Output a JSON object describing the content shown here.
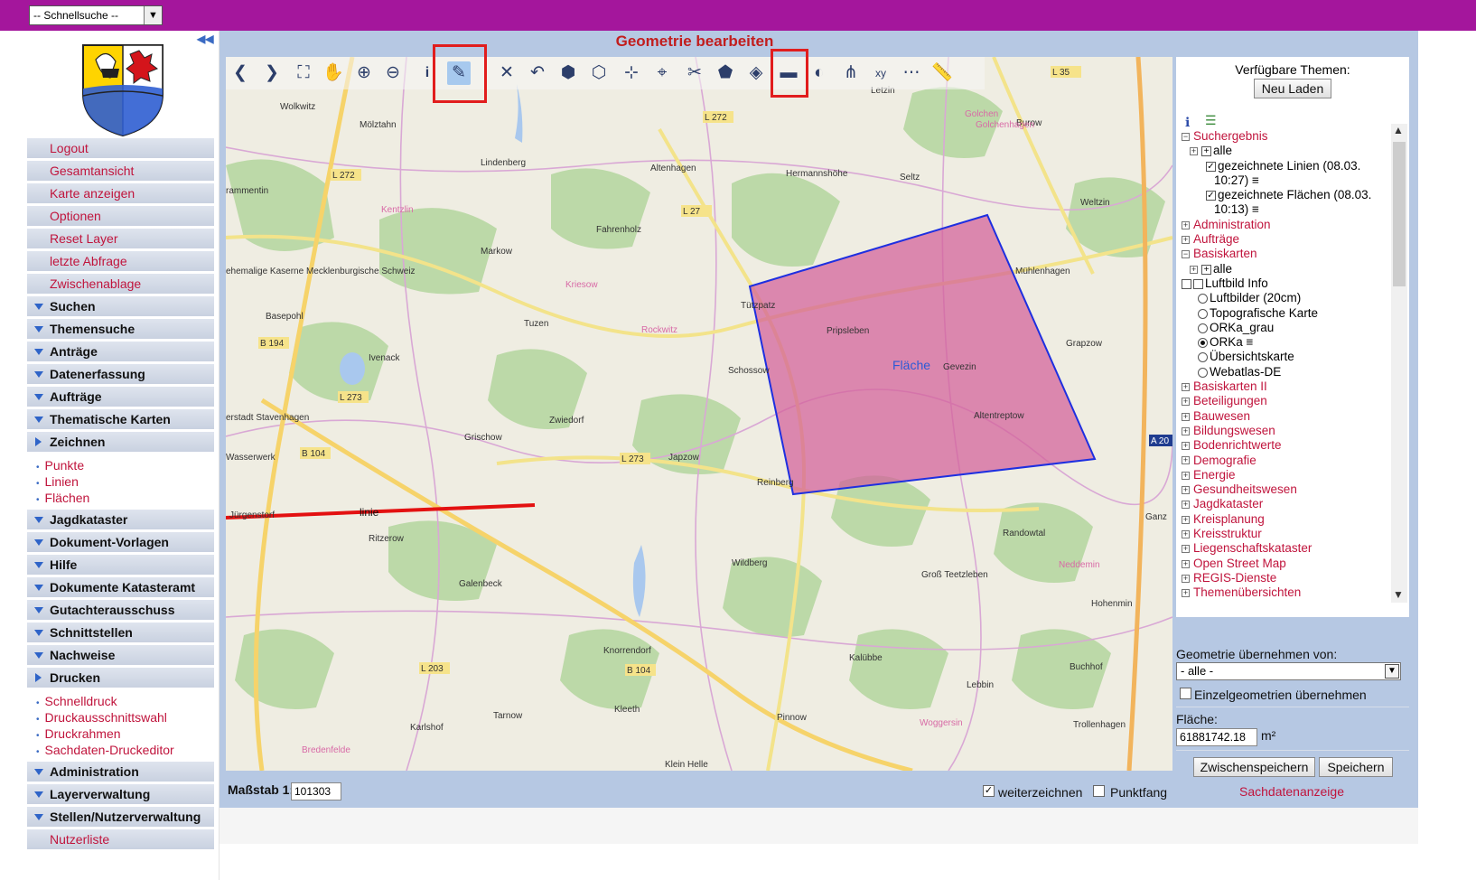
{
  "quicksearch": {
    "value": "-- Schnellsuche --"
  },
  "sidebar": {
    "collapse_icon": "double-chevron-left-icon",
    "menu": [
      {
        "label": "Logout",
        "kind": "red"
      },
      {
        "label": "Gesamtansicht",
        "kind": "red"
      },
      {
        "label": "Karte anzeigen",
        "kind": "red"
      },
      {
        "label": "Optionen",
        "kind": "red"
      },
      {
        "label": "Reset Layer",
        "kind": "red"
      },
      {
        "label": "letzte Abfrage",
        "kind": "red"
      },
      {
        "label": "Zwischenablage",
        "kind": "red"
      },
      {
        "label": "Suchen",
        "kind": "section"
      },
      {
        "label": "Themensuche",
        "kind": "section"
      },
      {
        "label": "Anträge",
        "kind": "section"
      },
      {
        "label": "Datenerfassung",
        "kind": "section"
      },
      {
        "label": "Aufträge",
        "kind": "section"
      },
      {
        "label": "Thematische Karten",
        "kind": "section"
      },
      {
        "label": "Zeichnen",
        "kind": "section-open",
        "sub": [
          "Punkte",
          "Linien",
          "Flächen"
        ]
      },
      {
        "label": "Jagdkataster",
        "kind": "section"
      },
      {
        "label": "Dokument-Vorlagen",
        "kind": "section"
      },
      {
        "label": "Hilfe",
        "kind": "section"
      },
      {
        "label": "Dokumente Katasteramt",
        "kind": "section"
      },
      {
        "label": "Gutachterausschuss",
        "kind": "section"
      },
      {
        "label": "Schnittstellen",
        "kind": "section"
      },
      {
        "label": "Nachweise",
        "kind": "section"
      },
      {
        "label": "Drucken",
        "kind": "section-open",
        "sub": [
          "Schnelldruck",
          "Druckausschnittswahl",
          "Druckrahmen",
          "Sachdaten-Druckeditor"
        ]
      },
      {
        "label": "Administration",
        "kind": "section"
      },
      {
        "label": "Layerverwaltung",
        "kind": "section"
      },
      {
        "label": "Stellen/Nutzerverwaltung",
        "kind": "section"
      },
      {
        "label": "Nutzerliste",
        "kind": "red"
      }
    ]
  },
  "main": {
    "title": "Geometrie bearbeiten",
    "scale_label": "Maßstab 1:",
    "scale_value": "101303",
    "weiterzeichnen_label": "weiterzeichnen",
    "weiterzeichnen_checked": true,
    "punktfang_label": "Punktfang",
    "punktfang_checked": false
  },
  "toolbar": {
    "icons": [
      "back-arrow-icon",
      "forward-arrow-icon",
      "fullextent-icon",
      "pan-hand-icon",
      "zoom-in-icon",
      "zoom-out-icon",
      "info-icon",
      "edit-pencil-icon",
      "delete-x-icon",
      "undo-icon",
      "polygon-edit-icon",
      "polygon-split-icon",
      "add-vertex-icon",
      "select-vertex-icon",
      "cut-polygon-icon",
      "union-polygon-icon",
      "buffer-icon",
      "line-tool-icon",
      "flip-icon",
      "split-line-icon",
      "coordinate-xy-icon",
      "measure-line-icon",
      "ruler-icon"
    ],
    "active": "edit-pencil-icon"
  },
  "map": {
    "polygon_label": "Fläche",
    "line_label": "linie",
    "place_labels": [
      "Wolkwitz",
      "Mölztahn",
      "Lindenberg",
      "Altenhagen",
      "Hermannshöhe",
      "Seltz",
      "Burow",
      "Golchen",
      "Weltzin",
      "Letzin",
      "Kentzlin",
      "Fahrenholz",
      "Markow",
      "Kriesow",
      "Tützpatz",
      "Tuzen",
      "Rockwitz",
      "Basepohl",
      "Ivenack",
      "Schossow",
      "Mühlenhagen",
      "Grapzow",
      "Zwiedorf",
      "Grischow",
      "Japzow",
      "Reinberg",
      "Altentreptow",
      "Jürgenstorf",
      "Ritzerow",
      "Wildberg",
      "Groß Teetzleben",
      "Galenbeck",
      "Knorrendorf",
      "Hohenmin",
      "Neddemin",
      "Gevezin",
      "Kalübbe",
      "Lebbin",
      "Buchhof",
      "Kleeth",
      "Tarnow",
      "Pinnow",
      "Woggersin",
      "Trollenhagen",
      "Karlshof",
      "Bredenfelde",
      "Klein Helle",
      "Ganz",
      "Pripsleben",
      "rammentin",
      "ehemalige Kaserne Mecklenburgische Schweiz",
      "erstadt Stavenhagen",
      "Wasserwerk",
      "Randowtal",
      "Golchenhagen"
    ],
    "road_labels": [
      "L 272",
      "L 272",
      "L 27",
      "L 35",
      "B 194",
      "L 273",
      "B 104",
      "L 273",
      "L 203",
      "B 104",
      "A 20"
    ]
  },
  "right": {
    "title": "Verfügbare Themen:",
    "reload_label": "Neu Laden",
    "tree": [
      {
        "t": "pm-",
        "label": "Suchergebnis",
        "red": true,
        "indent": 0
      },
      {
        "t": "pm+cb",
        "label": "alle",
        "indent": 1
      },
      {
        "t": "cb",
        "checked": true,
        "label": "gezeichnete Linien (08.03.",
        "indent": 3
      },
      {
        "t": "none",
        "label": "10:27) ≡",
        "indent": 4
      },
      {
        "t": "cb",
        "checked": true,
        "label": "gezeichnete Flächen (08.03.",
        "indent": 3
      },
      {
        "t": "none",
        "label": "10:13) ≡",
        "indent": 4
      },
      {
        "t": "pm+",
        "label": "Administration",
        "red": true,
        "indent": 0
      },
      {
        "t": "pm+",
        "label": "Aufträge",
        "red": true,
        "indent": 0
      },
      {
        "t": "pm-",
        "label": "Basiskarten",
        "red": true,
        "indent": 0
      },
      {
        "t": "pm+cb",
        "label": "alle",
        "indent": 1
      },
      {
        "t": "cbcb",
        "label": "Luftbild Info",
        "indent": 0
      },
      {
        "t": "rb",
        "label": "Luftbilder (20cm)",
        "indent": 2
      },
      {
        "t": "rb",
        "label": "Topografische Karte",
        "indent": 2
      },
      {
        "t": "rb",
        "label": "ORKa_grau",
        "indent": 2
      },
      {
        "t": "rb-on",
        "label": "ORKa ≡",
        "indent": 2
      },
      {
        "t": "rb",
        "label": "Übersichtskarte",
        "indent": 2
      },
      {
        "t": "rb",
        "label": "Webatlas-DE",
        "indent": 2
      },
      {
        "t": "pm+",
        "label": "Basiskarten II",
        "red": true,
        "indent": 0
      },
      {
        "t": "pm+",
        "label": "Beteiligungen",
        "red": true,
        "indent": 0
      },
      {
        "t": "pm+",
        "label": "Bauwesen",
        "red": true,
        "indent": 0
      },
      {
        "t": "pm+",
        "label": "Bildungswesen",
        "red": true,
        "indent": 0
      },
      {
        "t": "pm+",
        "label": "Bodenrichtwerte",
        "red": true,
        "indent": 0
      },
      {
        "t": "pm+",
        "label": "Demografie",
        "red": true,
        "indent": 0
      },
      {
        "t": "pm+",
        "label": "Energie",
        "red": true,
        "indent": 0
      },
      {
        "t": "pm+",
        "label": "Gesundheitswesen",
        "red": true,
        "indent": 0
      },
      {
        "t": "pm+",
        "label": "Jagdkataster",
        "red": true,
        "indent": 0
      },
      {
        "t": "pm+",
        "label": "Kreisplanung",
        "red": true,
        "indent": 0
      },
      {
        "t": "pm+",
        "label": "Kreisstruktur",
        "red": true,
        "indent": 0
      },
      {
        "t": "pm+",
        "label": "Liegenschaftskataster",
        "red": true,
        "indent": 0
      },
      {
        "t": "pm+",
        "label": "Open Street Map",
        "red": true,
        "indent": 0
      },
      {
        "t": "pm+",
        "label": "REGIS-Dienste",
        "red": true,
        "indent": 0
      },
      {
        "t": "pm+",
        "label": "Themenübersichten",
        "red": true,
        "indent": 0
      }
    ],
    "geom_label": "Geometrie übernehmen von:",
    "geom_select": "- alle -",
    "einzel_label": "Einzelgeometrien übernehmen",
    "flaeche_label": "Fläche:",
    "flaeche_value": "61881742.18",
    "flaeche_unit": "m²",
    "zwischenspeichern_label": "Zwischenspeichern",
    "speichern_label": "Speichern",
    "sachdaten_label": "Sachdatenanzeige"
  }
}
